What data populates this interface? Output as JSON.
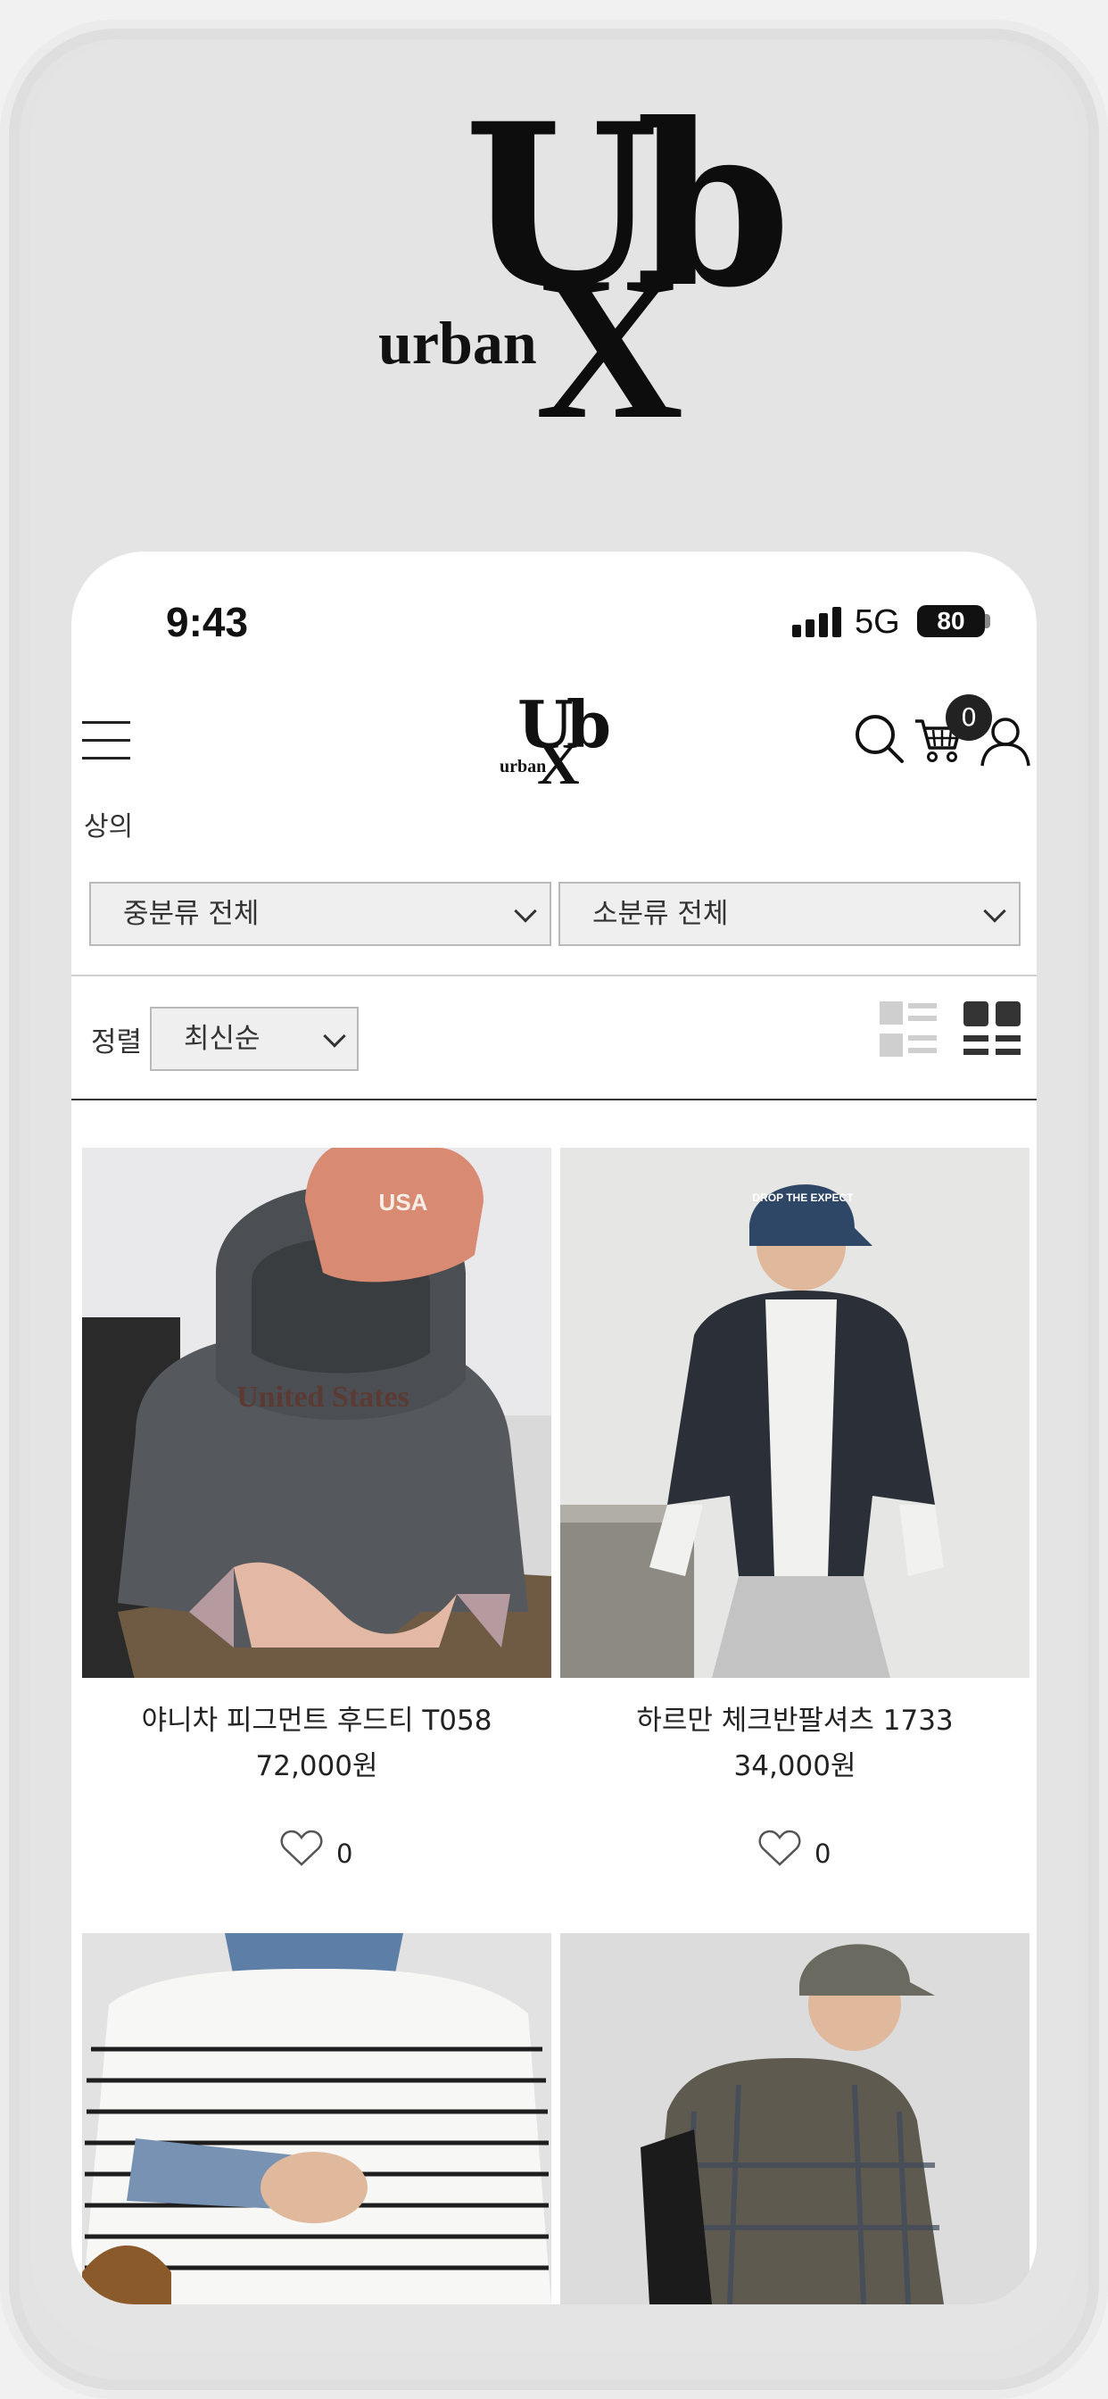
{
  "brand": {
    "mark": "Ub",
    "mark_x": "X",
    "wordmark": "urban"
  },
  "status_bar": {
    "time": "9:43",
    "network": "5G",
    "battery": "80"
  },
  "header": {
    "cart_count": "0"
  },
  "category": {
    "title": "상의"
  },
  "filters": {
    "mid_category": "중분류 전체",
    "sub_category": "소분류 전체"
  },
  "sort": {
    "label": "정렬",
    "value": "최신순"
  },
  "products": [
    {
      "name": "야니차 피그먼트 후드티 T058",
      "price": "72,000원",
      "likes": "0"
    },
    {
      "name": "하르만 체크반팔셔츠 1733",
      "price": "34,000원",
      "likes": "0"
    }
  ],
  "photo_text": {
    "cap1": "USA",
    "hoodie": "United States",
    "cap2": "DROP THE EXPECT"
  }
}
